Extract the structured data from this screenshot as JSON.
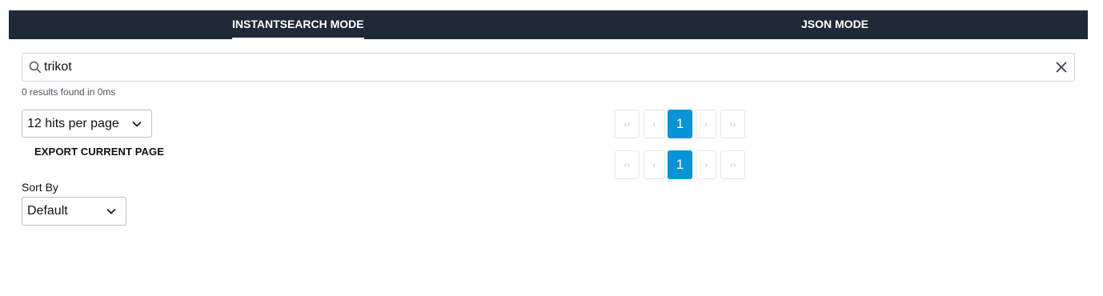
{
  "tabs": {
    "instantsearch_label": "INSTANTSEARCH MODE",
    "json_label": "JSON MODE"
  },
  "search": {
    "value": "trikot",
    "placeholder": ""
  },
  "stats": "0 results found in 0ms",
  "hits_per_page": {
    "selected": "12 hits per page"
  },
  "export_label": "EXPORT CURRENT PAGE",
  "sort": {
    "label": "Sort By",
    "selected": "Default"
  },
  "pagination": {
    "first": "‹‹",
    "prev": "‹",
    "current": "1",
    "next": "›",
    "last": "››"
  },
  "colors": {
    "topbar": "#1f2937",
    "accent": "#0794d6"
  }
}
